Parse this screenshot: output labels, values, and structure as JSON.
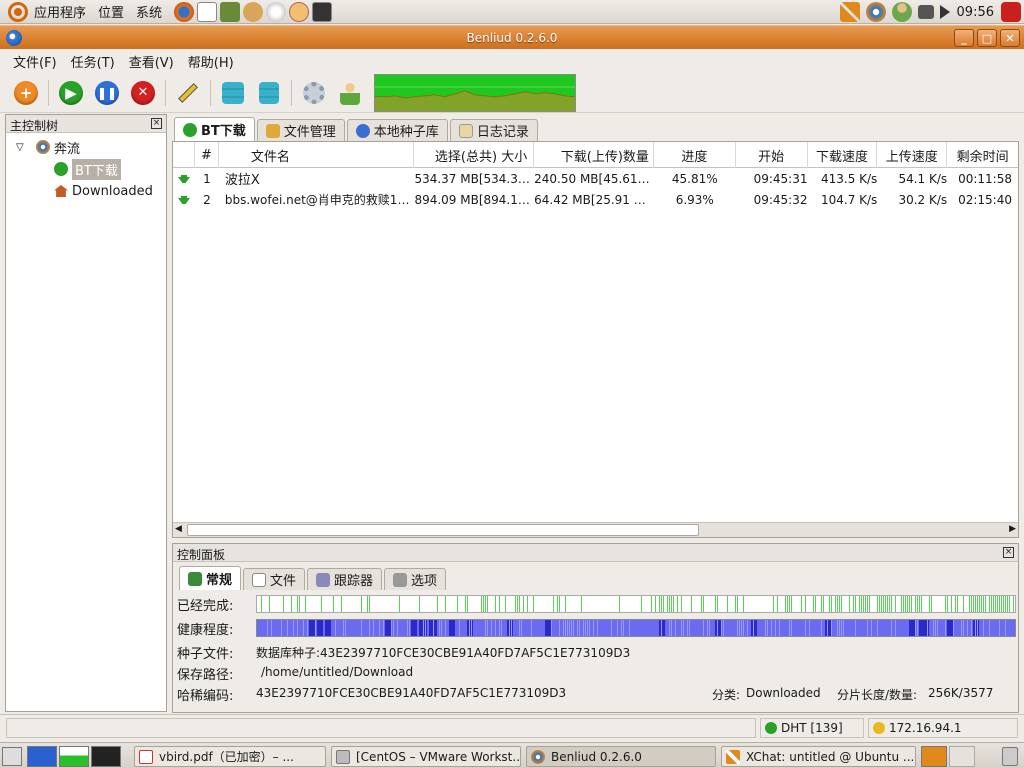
{
  "top_panel": {
    "menus": [
      "应用程序",
      "位置",
      "系统"
    ],
    "clock": "09:56"
  },
  "window": {
    "title": "Benliud 0.2.6.0",
    "min": "_",
    "max": "□",
    "close": "✕"
  },
  "menubar": [
    "文件(F)",
    "任务(T)",
    "查看(V)",
    "帮助(H)"
  ],
  "sidebar": {
    "title": "主控制树",
    "close": "×",
    "root": "奔流",
    "items": [
      "BT下载",
      "Downloaded"
    ]
  },
  "tabs": [
    "BT下载",
    "文件管理",
    "本地种子库",
    "日志记录"
  ],
  "table": {
    "columns": [
      "#",
      "文件名",
      "选择(总共) 大小",
      "下载(上传)数量",
      "进度",
      "开始",
      "下载速度",
      "上传速度",
      "剩余时间"
    ],
    "rows": [
      [
        "1",
        "波拉X",
        "534.37 MB[534.37 ...",
        "240.50 MB[45.61 ...",
        "45.81%",
        "09:45:31",
        "413.5 K/s",
        "54.1 K/s",
        "00:11:58"
      ],
      [
        "2",
        "bbs.wofei.net@肖申克的救赎10...",
        "894.09 MB[894.16 ...",
        "64.42 MB[25.91 MB]",
        "6.93%",
        "09:45:32",
        "104.7 K/s",
        "30.2 K/s",
        "02:15:40"
      ]
    ]
  },
  "control_panel": {
    "title": "控制面板",
    "close": "×",
    "tabs": [
      "常规",
      "文件",
      "跟踪器",
      "选项"
    ],
    "completed_label": "已经完成:",
    "health_label": "健康程度:",
    "seed_label": "种子文件:",
    "seed_value": "数据库种子:43E2397710FCE30CBE91A40FD7AF5C1E773109D3",
    "path_label": "保存路径:",
    "path_value": "/home/untitled/Download",
    "hash_label": "哈稀编码:",
    "hash_value": "43E2397710FCE30CBE91A40FD7AF5C1E773109D3",
    "category_label": "分类:",
    "category_value": "Downloaded",
    "piece_label": "分片长度/数量:",
    "piece_value": "256K/3577"
  },
  "statusbar": {
    "dht": "DHT [139]",
    "ip": "172.16.94.1"
  },
  "taskbar": [
    "vbird.pdf（已加密）– ...",
    "[CentOS – VMware Workst...",
    "Benliud 0.2.6.0",
    "XChat: untitled @ Ubuntu ..."
  ],
  "colors": {
    "title_orange": "#d9802c",
    "graph_green": "#1fc81f",
    "graph_fill": "#c28a2e",
    "health_blue": "#6b6bf2"
  }
}
